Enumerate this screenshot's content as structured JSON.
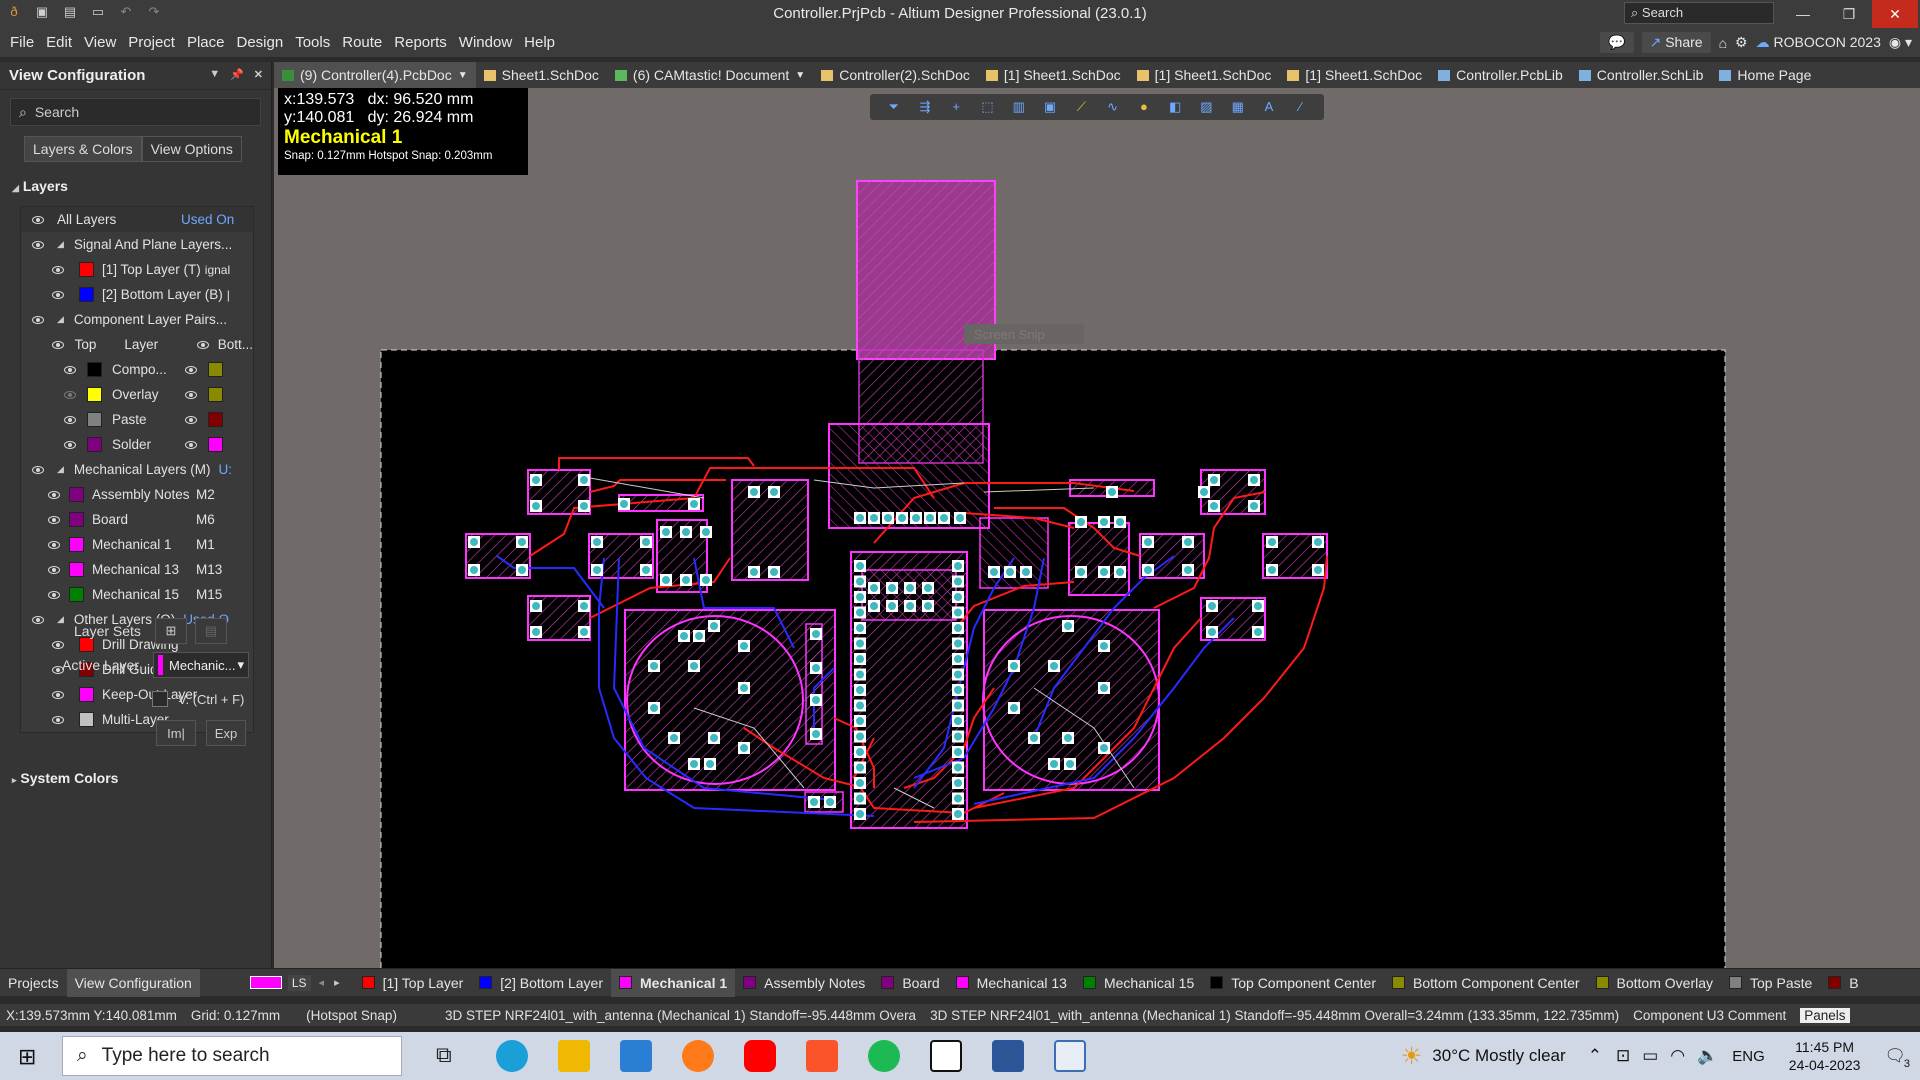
{
  "window": {
    "title": "Controller.PrjPcb - Altium Designer Professional (23.0.1)",
    "search_placeholder": "Search"
  },
  "menu": [
    "File",
    "Edit",
    "View",
    "Project",
    "Place",
    "Design",
    "Tools",
    "Route",
    "Reports",
    "Window",
    "Help"
  ],
  "menu_right": {
    "share": "Share",
    "account": "ROBOCON 2023"
  },
  "panel": {
    "title": "View Configuration",
    "search_placeholder": "Search",
    "tabs": [
      "Layers & Colors",
      "View Options"
    ],
    "layers_section": "Layers",
    "all_layers": "All Layers",
    "used_on": "Used On",
    "signal_group": "Signal And Plane Layers...",
    "signal_layers": [
      {
        "name": "[1] Top Layer (T)",
        "extra": "ignal",
        "color": "#ff0000"
      },
      {
        "name": "[2] Bottom Layer (B)",
        "extra": "|",
        "color": "#0000ff"
      }
    ],
    "component_group": "Component Layer Pairs...",
    "component_header": {
      "top": "Top",
      "layer": "Layer",
      "bottom": "Bott..."
    },
    "component_pairs": [
      {
        "name": "Compo...",
        "top_color": "#000000",
        "bottom_color": "#8a8a00",
        "visible": true
      },
      {
        "name": "Overlay",
        "top_color": "#ffff00",
        "bottom_color": "#8a8a00",
        "visible": false
      },
      {
        "name": "Paste",
        "top_color": "#808080",
        "bottom_color": "#800000",
        "visible": true
      },
      {
        "name": "Solder",
        "top_color": "#800080",
        "bottom_color": "#ff00ff",
        "visible": true
      }
    ],
    "mechanical_group": "Mechanical Layers (M)",
    "mechanical_used": "U:",
    "mechanical_layers": [
      {
        "name": "Assembly Notes",
        "code": "M2",
        "color": "#800080"
      },
      {
        "name": "Board",
        "code": "M6",
        "color": "#800080"
      },
      {
        "name": "Mechanical 1",
        "code": "M1",
        "color": "#ff00ff"
      },
      {
        "name": "Mechanical 13",
        "code": "M13",
        "color": "#ff00ff"
      },
      {
        "name": "Mechanical 15",
        "code": "M15",
        "color": "#008000"
      }
    ],
    "other_group": "Other Layers (O)",
    "other_used": "Used O",
    "other_layers": [
      {
        "name": "Drill Drawing",
        "color": "#ff0000"
      },
      {
        "name": "Drill Guide",
        "color": "#800000"
      },
      {
        "name": "Keep-Out Layer",
        "color": "#ff00ff"
      },
      {
        "name": "Multi-Layer",
        "color": "#c0c0c0"
      }
    ],
    "layer_sets_label": "Layer Sets",
    "active_layer_label": "Active Layer",
    "active_layer_value": "Mechanic...",
    "active_layer_color": "#ff00ff",
    "v_toggle": "V. (Ctrl + F)",
    "import_btn": "Im|",
    "export_btn": "Exp",
    "system_colors": "System Colors"
  },
  "doc_tabs": [
    {
      "label": "(9) Controller(4).PcbDoc",
      "icon": "pcb-icon",
      "color": "#3b8f3b",
      "active": true
    },
    {
      "label": "Sheet1.SchDoc",
      "icon": "sch-icon",
      "color": "#e8c26a"
    },
    {
      "label": "(6) CAMtastic! Document",
      "icon": "cam-icon",
      "color": "#5cb85c"
    },
    {
      "label": "Controller(2).SchDoc",
      "icon": "sch-icon",
      "color": "#e8c26a"
    },
    {
      "label": "[1] Sheet1.SchDoc",
      "icon": "sch-icon",
      "color": "#e8c26a"
    },
    {
      "label": "[1] Sheet1.SchDoc",
      "icon": "sch-icon",
      "color": "#e8c26a"
    },
    {
      "label": "[1] Sheet1.SchDoc",
      "icon": "sch-icon",
      "color": "#e8c26a"
    },
    {
      "label": "Controller.PcbLib",
      "icon": "pcblib-icon",
      "color": "#7fb0e0"
    },
    {
      "label": "Controller.SchLib",
      "icon": "schlib-icon",
      "color": "#7fb0e0"
    },
    {
      "label": "Home Page",
      "icon": "home-icon",
      "color": "#7fb0e0"
    }
  ],
  "coords": {
    "line1": "x:139.573   dx: 96.520 mm",
    "line2": "y:140.081   dy: 26.924 mm",
    "layer": "Mechanical 1",
    "snap": "Snap: 0.127mm Hotspot Snap: 0.203mm"
  },
  "canvas_ghost": "Screen Snip",
  "layer_tabs": {
    "ls": "LS",
    "tabs": [
      {
        "label": "[1] Top Layer",
        "color": "#ff0000"
      },
      {
        "label": "[2] Bottom Layer",
        "color": "#0000ff"
      },
      {
        "label": "Mechanical 1",
        "color": "#ff00ff",
        "selected": true
      },
      {
        "label": "Assembly Notes",
        "color": "#800080"
      },
      {
        "label": "Board",
        "color": "#800080"
      },
      {
        "label": "Mechanical 13",
        "color": "#ff00ff"
      },
      {
        "label": "Mechanical 15",
        "color": "#008000"
      },
      {
        "label": "Top Component Center",
        "color": "#000000"
      },
      {
        "label": "Bottom Component Center",
        "color": "#8a8a00"
      },
      {
        "label": "Bottom Overlay",
        "color": "#8a8a00"
      },
      {
        "label": "Top Paste",
        "color": "#808080"
      },
      {
        "label": "B",
        "color": "#800000"
      }
    ]
  },
  "panel_bottom_tabs": [
    "Projects",
    "View Configuration"
  ],
  "status": {
    "xy": "X:139.573mm Y:140.081mm",
    "grid": "Grid: 0.127mm",
    "snap": "(Hotspot Snap)",
    "info1": "3D STEP NRF24l01_with_antenna (Mechanical 1)  Standoff=-95.448mm  Overa",
    "info2": "3D STEP NRF24l01_with_antenna (Mechanical 1)  Standoff=-95.448mm  Overall=3.24mm  (133.35mm, 122.735mm)",
    "info3": "Component U3 Comment",
    "panels": "Panels"
  },
  "taskbar": {
    "search_placeholder": "Type here to search",
    "weather": "30°C  Mostly clear",
    "lang": "ENG",
    "time": "11:45 PM",
    "date": "24-04-2023",
    "notifications": "3"
  }
}
